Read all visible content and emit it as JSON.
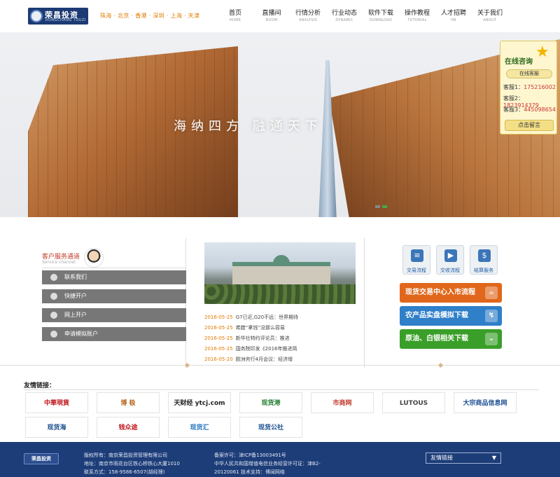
{
  "header": {
    "logo_text": "荣昌投资",
    "logo_sub": "RONGCHANG TOUZI",
    "cities": "珠海 · 北京 · 香港 · 深圳 · 上海 · 天津",
    "nav": [
      {
        "cn": "首页",
        "en": "HOME"
      },
      {
        "cn": "直播间",
        "en": "ROOM"
      },
      {
        "cn": "行情分析",
        "en": "ANALYSIS"
      },
      {
        "cn": "行业动态",
        "en": "DYNAMIC"
      },
      {
        "cn": "软件下载",
        "en": "DOWNLOAD"
      },
      {
        "cn": "操作教程",
        "en": "TUTORIAL"
      },
      {
        "cn": "人才招聘",
        "en": "HR"
      },
      {
        "cn": "关于我们",
        "en": "ABOUT"
      }
    ]
  },
  "banner": {
    "slogan": "海纳四方  融通天下"
  },
  "consult": {
    "title": "在线咨询",
    "service": "在线客服",
    "kf": [
      {
        "label": "客服1：",
        "num": "175216002"
      },
      {
        "label": "客服2：",
        "num": "1823914379"
      },
      {
        "label": "客服3：",
        "num": "445098654"
      }
    ],
    "message": "点击留言"
  },
  "service": {
    "title": "客户服务通道",
    "sub": "Service channel",
    "buttons": [
      "联系我们",
      "快捷开户",
      "网上开户",
      "申请模拟账户"
    ]
  },
  "news": [
    {
      "date": "2016-05-25",
      "title": "G7已近,G20不远：世界期待"
    },
    {
      "date": "2016-05-25",
      "title": "希腊“拿钱”没那么容易"
    },
    {
      "date": "2016-05-25",
      "title": "新华社特约评论员：推进"
    },
    {
      "date": "2016-05-25",
      "title": "国务院印发《2016年推进简"
    },
    {
      "date": "2016-05-20",
      "title": "欧洲央行4月会议：经济增"
    }
  ],
  "quick": [
    {
      "label": "交易流程",
      "glyph": "≡"
    },
    {
      "label": "交收流程",
      "glyph": "▶"
    },
    {
      "label": "结算服务",
      "glyph": "$"
    }
  ],
  "big_buttons": [
    {
      "label": "现货交易中心入市流程",
      "icon": "☕"
    },
    {
      "label": "农产品实盘模拟下载",
      "icon": "↯"
    },
    {
      "label": "原油、白银相关下载",
      "icon": "⌄"
    }
  ],
  "links": {
    "title": "友情链接：",
    "items": [
      {
        "text": "中華現貨",
        "color": "#c0141b"
      },
      {
        "text": "博 极",
        "color": "#b5651d"
      },
      {
        "text": "天财经 ytcj.com",
        "color": "#222"
      },
      {
        "text": "现货港",
        "color": "#1f7a2e"
      },
      {
        "text": "市商网",
        "color": "#c0392b"
      },
      {
        "text": "LUTOUS",
        "color": "#444"
      },
      {
        "text": "大宗商品信息网",
        "color": "#1d4f91"
      },
      {
        "text": "现货海",
        "color": "#1d4f91"
      },
      {
        "text": "钱众途",
        "color": "#c0141b"
      },
      {
        "text": "现货汇",
        "color": "#2a78c2"
      },
      {
        "text": "现货公社",
        "color": "#1d4f91"
      }
    ]
  },
  "footer": {
    "logo": "荣昌投资",
    "copyright": "版权所有：南京荣昌投资管理有限公司",
    "address": "地址：南京市雨花台区铁心桥铁心大厦1010",
    "contact": "联系方式：158-9586-6507(胡经理)",
    "icp": "备案许可：津ICP备13003491号",
    "license": "中华人民共和国增值电信业务经营许可证：津B2-",
    "license2": "20120061 技术支持：博闻网络",
    "select": "友情链接"
  }
}
